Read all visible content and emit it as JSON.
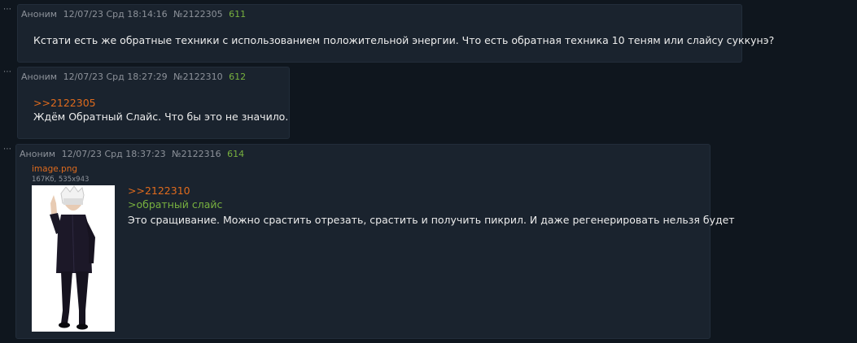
{
  "posts": [
    {
      "author": "Аноним",
      "date": "12/07/23 Срд 18:14:16",
      "id": "№2122305",
      "num": "611",
      "text": "Кстати есть же обратные техники с использованием положительной энергии. Что есть обратная техника 10 теням или слайсу суккунэ?"
    },
    {
      "author": "Аноним",
      "date": "12/07/23 Срд 18:27:29",
      "id": "№2122310",
      "num": "612",
      "reply": ">>2122305",
      "text": "Ждём Обратный Слайс. Что бы это не значило."
    },
    {
      "author": "Аноним",
      "date": "12/07/23 Срд 18:37:23",
      "id": "№2122316",
      "num": "614",
      "file_name": "image.png",
      "file_meta": "167Кб, 535x943",
      "reply": ">>2122310",
      "quote": ">обратный слайс",
      "text": "Это сращивание. Можно срастить отрезать, срастить и получить пикрил. И даже регенерировать нельзя будет"
    }
  ]
}
